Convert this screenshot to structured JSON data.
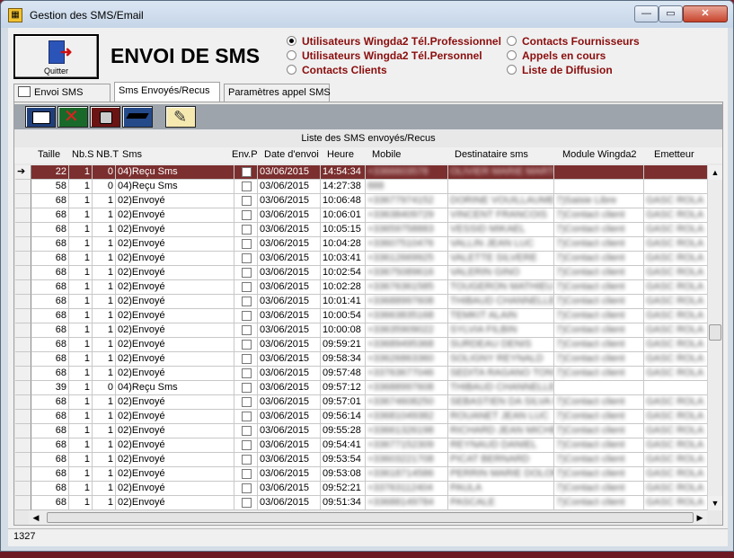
{
  "window": {
    "title": "Gestion des SMS/Email",
    "min": "—",
    "max": "▭",
    "close": "✕"
  },
  "quit_label": "Quitter",
  "heading": "ENVOI DE SMS",
  "radios": [
    {
      "label": "Utilisateurs Wingda2 Tél.Professionnel",
      "selected": true
    },
    {
      "label": "Utilisateurs Wingda2 Tél.Personnel",
      "selected": false
    },
    {
      "label": "Contacts Clients",
      "selected": false
    },
    {
      "label": "Contacts Fournisseurs",
      "selected": false
    },
    {
      "label": "Appels en cours",
      "selected": false
    },
    {
      "label": "Liste de Diffusion",
      "selected": false
    }
  ],
  "tabs": [
    {
      "label": "Envoi SMS",
      "icon": "envelope-form-icon"
    },
    {
      "label": "Sms Envoyés/Recus",
      "active": true
    },
    {
      "label": "Paramètres appel SMS"
    }
  ],
  "toolbar_icons": [
    "mail-icon",
    "delete-icon",
    "trash-icon",
    "send-icon",
    "edit-icon"
  ],
  "grid": {
    "caption": "Liste des SMS envoyés/Recus",
    "headers": {
      "taille": "Taille",
      "nbs": "Nb.S",
      "nbt": "NB.T",
      "sms": "Sms",
      "envp": "Env.P",
      "date": "Date d'envoi",
      "heure": "Heure",
      "mobile": "Mobile",
      "dest": "Destinataire sms",
      "module": "Module Wingda2",
      "emet": "Emetteur"
    },
    "rows": [
      {
        "taille": "22",
        "nbs": "1",
        "nbt": "0",
        "sms": "04)Reçu Sms",
        "date": "03/06/2015",
        "heure": "14:54:34",
        "mobile": "+3366603578",
        "dest": "OLIVIER MARIE MARTINE",
        "module": "",
        "emet": "",
        "selected": true
      },
      {
        "taille": "58",
        "nbs": "1",
        "nbt": "0",
        "sms": "04)Reçu Sms",
        "date": "03/06/2015",
        "heure": "14:27:38",
        "mobile": "888",
        "dest": "",
        "module": "",
        "emet": ""
      },
      {
        "taille": "68",
        "nbs": "1",
        "nbt": "1",
        "sms": "02)Envoyé",
        "date": "03/06/2015",
        "heure": "10:06:48",
        "mobile": "+33677974152",
        "dest": "DORINE VOUILLAUME",
        "module": "7)Saisie Libre",
        "emet": "GASC ROLA"
      },
      {
        "taille": "68",
        "nbs": "1",
        "nbt": "1",
        "sms": "02)Envoyé",
        "date": "03/06/2015",
        "heure": "10:06:01",
        "mobile": "+33638409729",
        "dest": "VINCENT FRANCOIS",
        "module": "7)Contact client",
        "emet": "GASC ROLA"
      },
      {
        "taille": "68",
        "nbs": "1",
        "nbt": "1",
        "sms": "02)Envoyé",
        "date": "03/06/2015",
        "heure": "10:05:15",
        "mobile": "+33659758883",
        "dest": "VESSID MIKAEL",
        "module": "7)Contact client",
        "emet": "GASC ROLA"
      },
      {
        "taille": "68",
        "nbs": "1",
        "nbt": "1",
        "sms": "02)Envoyé",
        "date": "03/06/2015",
        "heure": "10:04:28",
        "mobile": "+33607510476",
        "dest": "VALLIN JEAN LUC",
        "module": "7)Contact client",
        "emet": "GASC ROLA"
      },
      {
        "taille": "68",
        "nbs": "1",
        "nbt": "1",
        "sms": "02)Envoyé",
        "date": "03/06/2015",
        "heure": "10:03:41",
        "mobile": "+33612669925",
        "dest": "VALETTE SILVERE",
        "module": "7)Contact client",
        "emet": "GASC ROLA"
      },
      {
        "taille": "68",
        "nbs": "1",
        "nbt": "1",
        "sms": "02)Envoyé",
        "date": "03/06/2015",
        "heure": "10:02:54",
        "mobile": "+33675089616",
        "dest": "VALERIN GINO",
        "module": "7)Contact client",
        "emet": "GASC ROLA"
      },
      {
        "taille": "68",
        "nbs": "1",
        "nbt": "1",
        "sms": "02)Envoyé",
        "date": "03/06/2015",
        "heure": "10:02:28",
        "mobile": "+33676361585",
        "dest": "TOUGERON MATHIEU",
        "module": "7)Contact client",
        "emet": "GASC ROLA"
      },
      {
        "taille": "68",
        "nbs": "1",
        "nbt": "1",
        "sms": "02)Envoyé",
        "date": "03/06/2015",
        "heure": "10:01:41",
        "mobile": "+33688997608",
        "dest": "THIBAUD CHANNELLE",
        "module": "7)Contact client",
        "emet": "GASC ROLA"
      },
      {
        "taille": "68",
        "nbs": "1",
        "nbt": "1",
        "sms": "02)Envoyé",
        "date": "03/06/2015",
        "heure": "10:00:54",
        "mobile": "+33663835168",
        "dest": "TEMKIT ALAIN",
        "module": "7)Contact client",
        "emet": "GASC ROLA"
      },
      {
        "taille": "68",
        "nbs": "1",
        "nbt": "1",
        "sms": "02)Envoyé",
        "date": "03/06/2015",
        "heure": "10:00:08",
        "mobile": "+33635909022",
        "dest": "SYLVIA FILBIN",
        "module": "7)Contact client",
        "emet": "GASC ROLA"
      },
      {
        "taille": "68",
        "nbs": "1",
        "nbt": "1",
        "sms": "02)Envoyé",
        "date": "03/06/2015",
        "heure": "09:59:21",
        "mobile": "+33689495368",
        "dest": "SURDEAU DENIS",
        "module": "7)Contact client",
        "emet": "GASC ROLA"
      },
      {
        "taille": "68",
        "nbs": "1",
        "nbt": "1",
        "sms": "02)Envoyé",
        "date": "03/06/2015",
        "heure": "09:58:34",
        "mobile": "+33626863360",
        "dest": "SOLIGNY REYNALD",
        "module": "7)Contact client",
        "emet": "GASC ROLA"
      },
      {
        "taille": "68",
        "nbs": "1",
        "nbt": "1",
        "sms": "02)Envoyé",
        "date": "03/06/2015",
        "heure": "09:57:48",
        "mobile": "+33763677046",
        "dest": "SEDITA RAGANO TONY",
        "module": "7)Contact client",
        "emet": "GASC ROLA"
      },
      {
        "taille": "39",
        "nbs": "1",
        "nbt": "0",
        "sms": "04)Reçu Sms",
        "date": "03/06/2015",
        "heure": "09:57:12",
        "mobile": "+33688997608",
        "dest": "THIBAUD CHANNELLE",
        "module": "",
        "emet": ""
      },
      {
        "taille": "68",
        "nbs": "1",
        "nbt": "1",
        "sms": "02)Envoyé",
        "date": "03/06/2015",
        "heure": "09:57:01",
        "mobile": "+33674608250",
        "dest": "SEBASTIEN DA SILVA F",
        "module": "7)Contact client",
        "emet": "GASC ROLA"
      },
      {
        "taille": "68",
        "nbs": "1",
        "nbt": "1",
        "sms": "02)Envoyé",
        "date": "03/06/2015",
        "heure": "09:56:14",
        "mobile": "+33681049382",
        "dest": "ROUANET JEAN LUC",
        "module": "7)Contact client",
        "emet": "GASC ROLA"
      },
      {
        "taille": "68",
        "nbs": "1",
        "nbt": "1",
        "sms": "02)Envoyé",
        "date": "03/06/2015",
        "heure": "09:55:28",
        "mobile": "+33661326198",
        "dest": "RICHARD JEAN MICHEL",
        "module": "7)Contact client",
        "emet": "GASC ROLA"
      },
      {
        "taille": "68",
        "nbs": "1",
        "nbt": "1",
        "sms": "02)Envoyé",
        "date": "03/06/2015",
        "heure": "09:54:41",
        "mobile": "+33677152309",
        "dest": "REYNAUD DANIEL",
        "module": "7)Contact client",
        "emet": "GASC ROLA"
      },
      {
        "taille": "68",
        "nbs": "1",
        "nbt": "1",
        "sms": "02)Envoyé",
        "date": "03/06/2015",
        "heure": "09:53:54",
        "mobile": "+33603221708",
        "dest": "PICAT BERNARD",
        "module": "7)Contact client",
        "emet": "GASC ROLA"
      },
      {
        "taille": "68",
        "nbs": "1",
        "nbt": "1",
        "sms": "02)Envoyé",
        "date": "03/06/2015",
        "heure": "09:53:08",
        "mobile": "+33618714586",
        "dest": "PERRIN MARIE DOLORES",
        "module": "7)Contact client",
        "emet": "GASC ROLA"
      },
      {
        "taille": "68",
        "nbs": "1",
        "nbt": "1",
        "sms": "02)Envoyé",
        "date": "03/06/2015",
        "heure": "09:52:21",
        "mobile": "+33763112404",
        "dest": "PAULA",
        "module": "7)Contact client",
        "emet": "GASC ROLA"
      },
      {
        "taille": "68",
        "nbs": "1",
        "nbt": "1",
        "sms": "02)Envoyé",
        "date": "03/06/2015",
        "heure": "09:51:34",
        "mobile": "+33688149784",
        "dest": "PASCALE",
        "module": "7)Contact client",
        "emet": "GASC ROLA"
      }
    ]
  },
  "status": "1327"
}
